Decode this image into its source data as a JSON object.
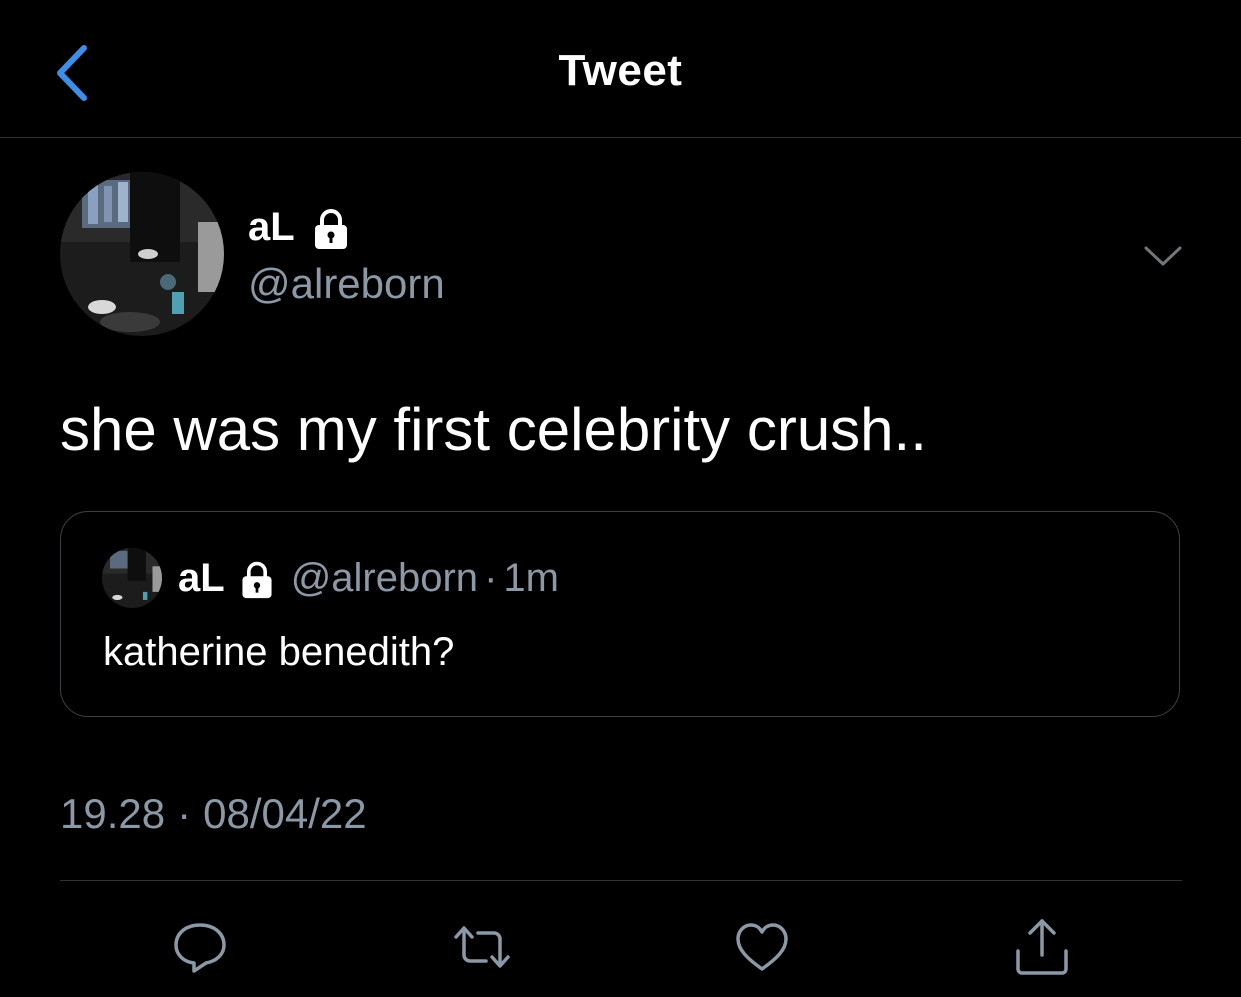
{
  "header": {
    "title": "Tweet",
    "back_icon": "chevron-left-icon"
  },
  "tweet": {
    "display_name": "aL",
    "handle": "@alreborn",
    "protected_icon": "lock-icon",
    "text": "she was my first celebrity crush..",
    "timestamp_time": "19.28",
    "timestamp_separator": "·",
    "timestamp_date": "08/04/22"
  },
  "quote": {
    "display_name": "aL",
    "handle": "@alreborn",
    "separator": "·",
    "time_ago": "1m",
    "text": "katherine benedith?"
  },
  "actions": [
    {
      "name": "reply",
      "icon": "reply-icon"
    },
    {
      "name": "retweet",
      "icon": "retweet-icon"
    },
    {
      "name": "like",
      "icon": "heart-icon"
    },
    {
      "name": "share",
      "icon": "share-icon"
    }
  ],
  "colors": {
    "background": "#000000",
    "accent": "#1d9bf0",
    "secondary_text": "#8b98a5",
    "border": "#2f3336",
    "icon": "#8b98a5"
  }
}
